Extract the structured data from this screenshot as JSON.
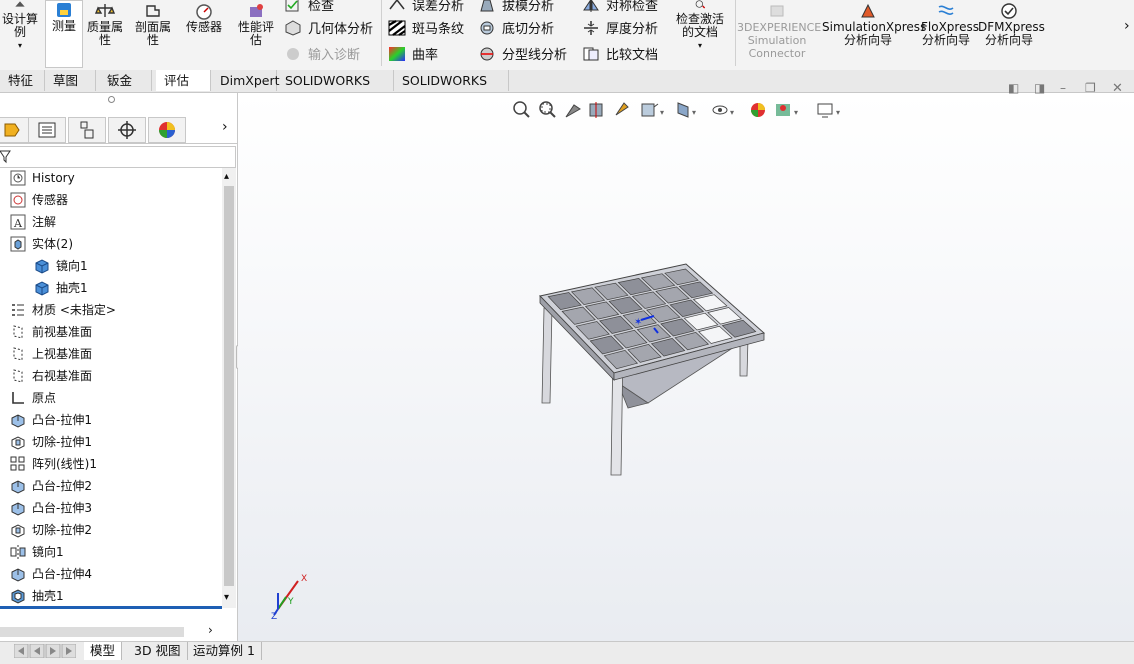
{
  "ribbon": {
    "design_study": "设计算例",
    "measure": "测量",
    "mass_props": "质量属性",
    "section_props": "剖面属性",
    "sensor": "传感器",
    "perf_eval": "性能评估",
    "check": "检查",
    "geom_analysis": "几何体分析",
    "import_diag": "输入诊断",
    "deviation": "误差分析",
    "zebra": "斑马条纹",
    "curvature": "曲率",
    "draft": "拔模分析",
    "undercut": "底切分析",
    "parting_line": "分型线分析",
    "symmetry": "对称检查",
    "thickness": "厚度分析",
    "compare_docs": "比较文档",
    "check_active_doc": "检查激活的文档",
    "exp_sim_connector": "3DEXPERIENCE Simulation Connector",
    "simxpress": "SimulationXpress 分析向导",
    "floxpress": "FloXpress 分析向导",
    "dfmxpress": "DFMXpress 分析向导"
  },
  "tabs": [
    "特征",
    "草图",
    "钣金",
    "评估",
    "DimXpert",
    "SOLIDWORKS 插件",
    "SOLIDWORKS MBD"
  ],
  "tree": [
    {
      "label": "History",
      "icon": "history-icon"
    },
    {
      "label": "传感器",
      "icon": "sensor-icon"
    },
    {
      "label": "注解",
      "icon": "annotation-icon"
    },
    {
      "label": "实体(2)",
      "icon": "solid-bodies-icon"
    },
    {
      "label": "镜向1",
      "icon": "body-icon"
    },
    {
      "label": "抽壳1",
      "icon": "body-icon"
    },
    {
      "label": "材质 <未指定>",
      "icon": "material-icon"
    },
    {
      "label": "前视基准面",
      "icon": "plane-icon"
    },
    {
      "label": "上视基准面",
      "icon": "plane-icon"
    },
    {
      "label": "右视基准面",
      "icon": "plane-icon"
    },
    {
      "label": "原点",
      "icon": "origin-icon"
    },
    {
      "label": "凸台-拉伸1",
      "icon": "boss-extrude-icon"
    },
    {
      "label": "切除-拉伸1",
      "icon": "cut-extrude-icon"
    },
    {
      "label": "阵列(线性)1",
      "icon": "linear-pattern-icon"
    },
    {
      "label": "凸台-拉伸2",
      "icon": "boss-extrude-icon"
    },
    {
      "label": "凸台-拉伸3",
      "icon": "boss-extrude-icon"
    },
    {
      "label": "切除-拉伸2",
      "icon": "cut-extrude-icon"
    },
    {
      "label": "镜向1",
      "icon": "mirror-icon"
    },
    {
      "label": "凸台-拉伸4",
      "icon": "boss-extrude-icon"
    },
    {
      "label": "抽壳1",
      "icon": "shell-icon"
    }
  ],
  "bottom_tabs": [
    "模型",
    "3D 视图",
    "运动算例 1"
  ],
  "triad": {
    "x": "X",
    "y": "Y",
    "z": "Z"
  },
  "colors": {
    "accent": "#0a64c8",
    "tree_end_bar": "#1e5fb4",
    "x_axis": "#d02020",
    "y_axis": "#20a020",
    "z_axis": "#2040d0"
  }
}
